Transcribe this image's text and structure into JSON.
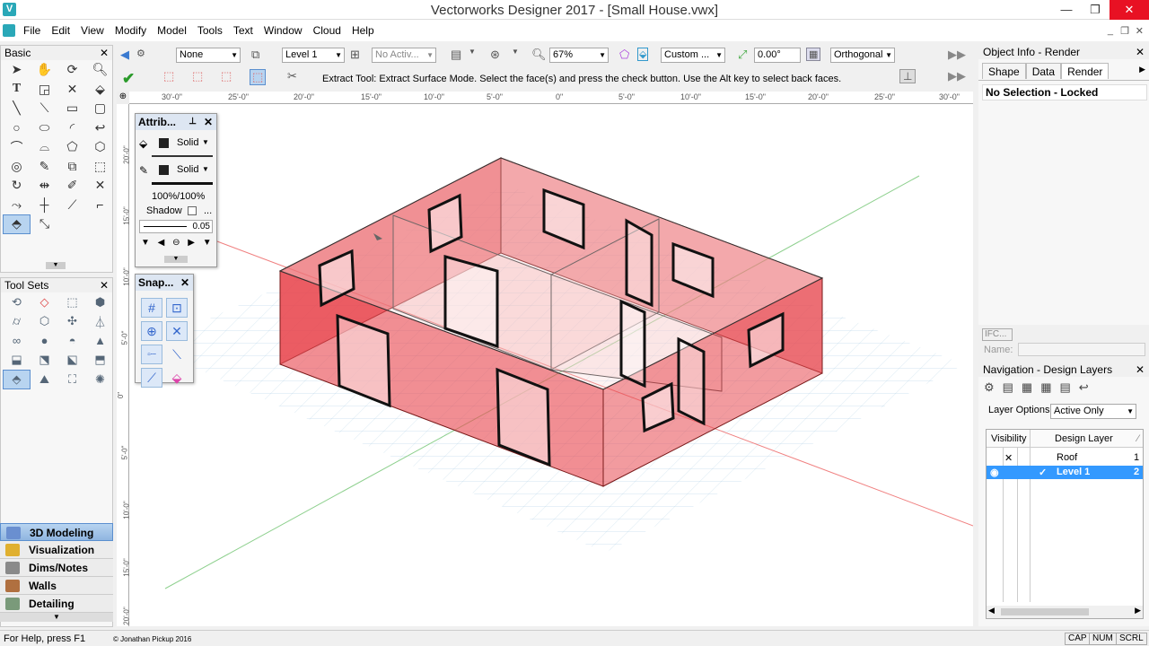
{
  "window": {
    "title": "Vectorworks Designer 2017 - [Small House.vwx]",
    "minimize": "—",
    "restore": "❐",
    "close": "✕"
  },
  "menu": [
    "File",
    "Edit",
    "View",
    "Modify",
    "Model",
    "Tools",
    "Text",
    "Window",
    "Cloud",
    "Help"
  ],
  "basic_palette": {
    "title": "Basic"
  },
  "toolsets_palette": {
    "title": "Tool Sets"
  },
  "palette_buttons": [
    {
      "label": "3D Modeling",
      "color": "#6a8fd0"
    },
    {
      "label": "Visualization",
      "color": "#e0b030"
    },
    {
      "label": "Dims/Notes",
      "color": "#8a8a8a"
    },
    {
      "label": "Walls",
      "color": "#b07040"
    },
    {
      "label": "Detailing",
      "color": "#7a9a7a"
    }
  ],
  "viewbar": {
    "class": "None",
    "layer": "Level 1",
    "active": "No Activ...",
    "zoom": "67%",
    "custom": "Custom ...",
    "angle": "0.00°",
    "projection": "Orthogonal"
  },
  "modebar": {
    "message": "Extract Tool: Extract Surface Mode. Select the face(s) and press the check button. Use the Alt key to select back faces."
  },
  "hruler": [
    "30'-0\"",
    "25'-0\"",
    "20'-0\"",
    "15'-0\"",
    "10'-0\"",
    "5'-0\"",
    "0\"",
    "5'-0\"",
    "10'-0\"",
    "15'-0\"",
    "20'-0\"",
    "25'-0\"",
    "30'-0\""
  ],
  "vruler": [
    "20'-0\"",
    "15'-0\"",
    "10'-0\"",
    "5'-0\"",
    "0\"",
    "5'-0\"",
    "10'-0\"",
    "15'-0\"",
    "20'-0\""
  ],
  "attributes": {
    "title": "Attrib...",
    "fill": "Solid",
    "pen": "Solid",
    "opacity": "100%/100%",
    "shadow": "Shadow",
    "more": "...",
    "line_weight": "0.05"
  },
  "snapping": {
    "title": "Snap..."
  },
  "object_info": {
    "title": "Object Info - Render",
    "tabs": [
      "Shape",
      "Data",
      "Render"
    ],
    "status": "No Selection - Locked",
    "ifc": "IFC...",
    "name_label": "Name:"
  },
  "navigation": {
    "title": "Navigation - Design Layers",
    "layer_options_label": "Layer Options:",
    "layer_options_value": "Active Only",
    "headers": [
      "Visibility",
      "Design Layer"
    ],
    "rows": [
      {
        "name": "Roof",
        "num": "1",
        "check": "",
        "vis": "✕"
      },
      {
        "name": "Level 1",
        "num": "2",
        "check": "✓",
        "vis": "◉"
      }
    ]
  },
  "status": {
    "help": "For Help, press F1",
    "copyright": "© Jonathan Pickup 2016",
    "caps": "CAP",
    "num": "NUM",
    "scrl": "SCRL"
  },
  "colors": {
    "wall": "#e84850",
    "accent": "#3399ff"
  }
}
